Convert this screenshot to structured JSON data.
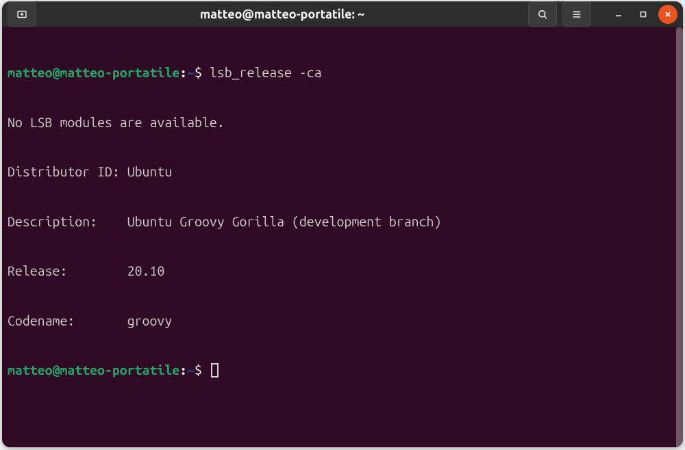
{
  "titlebar": {
    "title": "matteo@matteo-portatile: ~"
  },
  "terminal": {
    "prompt_user": "matteo@matteo-portatile",
    "prompt_sep": ":",
    "prompt_path": "~",
    "prompt_dollar": "$",
    "command1": "lsb_release -ca",
    "output_lines": {
      "l0": "No LSB modules are available.",
      "l1": "Distributor ID: Ubuntu",
      "l2": "Description:    Ubuntu Groovy Gorilla (development branch)",
      "l3": "Release:        20.10",
      "l4": "Codename:       groovy"
    }
  }
}
